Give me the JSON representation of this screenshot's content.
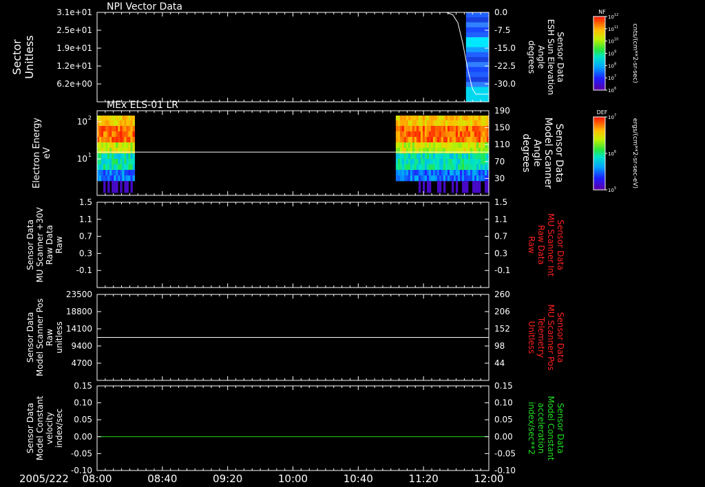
{
  "date_label": "2005/222",
  "time_ticks": [
    "08:00",
    "08:40",
    "09:20",
    "10:00",
    "10:40",
    "11:20",
    "12:00"
  ],
  "panels": [
    {
      "title": "NPI Vector Data",
      "left_label": [
        "Sector",
        "Unitless"
      ],
      "left_ticks": [
        "3.1e+01",
        "2.5e+01",
        "1.9e+01",
        "1.2e+01",
        "6.2e+00"
      ],
      "right_ticks": [
        "0.0",
        "-7.5",
        "-15.0",
        "-22.5",
        "-30.0"
      ],
      "right_label": [
        "Sensor Data",
        "ESH Sun Elevation",
        "Angle",
        "degrees"
      ],
      "right_color": "#ffffff"
    },
    {
      "title": "MEx ELS-01 LR",
      "left_label": [
        "Electron Energy",
        "eV"
      ],
      "left_ticks": [
        "10",
        "10"
      ],
      "left_tick_exps": [
        "2",
        "1"
      ],
      "right_ticks": [
        "190",
        "150",
        "110",
        "70",
        "30"
      ],
      "right_label": [
        "Sensor Data",
        "Model Scanner",
        "Angle",
        "degrees"
      ],
      "right_color": "#ffffff"
    },
    {
      "title": "",
      "left_label": [
        "Sensor Data",
        "MU Scanner +30V",
        "Raw Data",
        "Raw"
      ],
      "left_ticks": [
        "1.5",
        "1.1",
        "0.7",
        "0.3",
        "-0.1"
      ],
      "right_ticks": [
        "1.5",
        "1.1",
        "0.7",
        "0.3",
        "-0.1"
      ],
      "right_label": [
        "Sensor Data",
        "MU Scanner Int",
        "Raw Data",
        "Raw"
      ],
      "right_color": "#ff2020"
    },
    {
      "title": "",
      "left_label": [
        "Sensor Data",
        "Model Scanner Pos",
        "Raw",
        "unitless"
      ],
      "left_ticks": [
        "23500",
        "18800",
        "14100",
        "9400",
        "4700"
      ],
      "right_ticks": [
        "260",
        "206",
        "152",
        "98",
        "44"
      ],
      "right_label": [
        "Sensor Data",
        "MU Scanner Pos",
        "Telemetry",
        "Unitless"
      ],
      "right_color": "#ff2020"
    },
    {
      "title": "",
      "left_label": [
        "Sensor Data",
        "Model Constant",
        "velocity",
        "index/sec"
      ],
      "left_ticks": [
        "0.15",
        "0.10",
        "0.05",
        "0.00",
        "-0.05",
        "-0.10"
      ],
      "right_ticks": [
        "0.15",
        "0.10",
        "0.05",
        "0.00",
        "-0.05",
        "-0.10"
      ],
      "right_label": [
        "Sensor Data",
        "Model Constant",
        "acceleration",
        "index/sec**2"
      ],
      "right_color": "#20e020"
    }
  ],
  "colorbars": [
    {
      "top_label": "NF",
      "tick_base": "10",
      "tick_exps": [
        "12",
        "11",
        "10",
        "9",
        "8",
        "7",
        "6"
      ],
      "unit": "cnts/(cm**2-sr-sec)"
    },
    {
      "top_label": "DEF",
      "tick_base": "10",
      "tick_exps": [
        "7",
        "6",
        "5"
      ],
      "unit": "ergs/(cm**2-sr-sec-eV)"
    }
  ],
  "chart_data": [
    {
      "type": "heatmap",
      "title": "NPI Vector Data",
      "xlabel": "",
      "ylabel": "Sector Unitless",
      "x_range": [
        "08:00",
        "12:00"
      ],
      "data_interval": [
        "11:46",
        "12:00"
      ],
      "overlay_line": {
        "name": "Sensor Data ESH Sun Elevation Angle degrees",
        "axis": "right",
        "ylim": [
          -35,
          0
        ],
        "points": [
          [
            "08:00",
            0
          ],
          [
            "11:34",
            0
          ],
          [
            "11:38",
            -1
          ],
          [
            "11:41",
            -4
          ],
          [
            "11:44",
            -12
          ],
          [
            "11:47",
            -22
          ],
          [
            "11:50",
            -30
          ],
          [
            "11:52",
            -32
          ],
          [
            "12:00",
            -32
          ]
        ]
      }
    },
    {
      "type": "heatmap",
      "title": "MEx ELS-01 LR",
      "ylabel": "Electron Energy eV",
      "log_y": true,
      "data_intervals": [
        [
          "08:00",
          "08:23"
        ],
        [
          "11:03",
          "12:00"
        ]
      ],
      "overlay_line": {
        "name": "Sensor Data Model Scanner Angle degrees",
        "axis": "right",
        "ylim": [
          10,
          190
        ],
        "value": 102
      }
    },
    {
      "type": "line",
      "ylabel": "Sensor Data MU Scanner +30V Raw Data Raw",
      "ylim": [
        -0.3,
        1.5
      ],
      "right_ylim": [
        -0.3,
        1.5
      ],
      "series": []
    },
    {
      "type": "line",
      "ylabel": "Sensor Data Model Scanner Pos Raw unitless",
      "ylim": [
        0,
        23500
      ],
      "right_ylim": [
        17,
        260
      ],
      "series": [
        {
          "name": "Sensor Data Model Scanner Pos Raw unitless",
          "axis": "left",
          "x": [
            "08:00",
            "12:00"
          ],
          "values": [
            11750,
            11750
          ]
        }
      ]
    },
    {
      "type": "line",
      "ylabel": "Sensor Data Model Constant velocity index/sec",
      "ylim": [
        -0.1,
        0.15
      ],
      "right_ylim": [
        -0.1,
        0.15
      ],
      "series": [
        {
          "name": "Sensor Data Model Constant acceleration index/sec**2",
          "axis": "right",
          "x": [
            "08:00",
            "12:00"
          ],
          "values": [
            0.0,
            0.0
          ]
        }
      ]
    }
  ]
}
